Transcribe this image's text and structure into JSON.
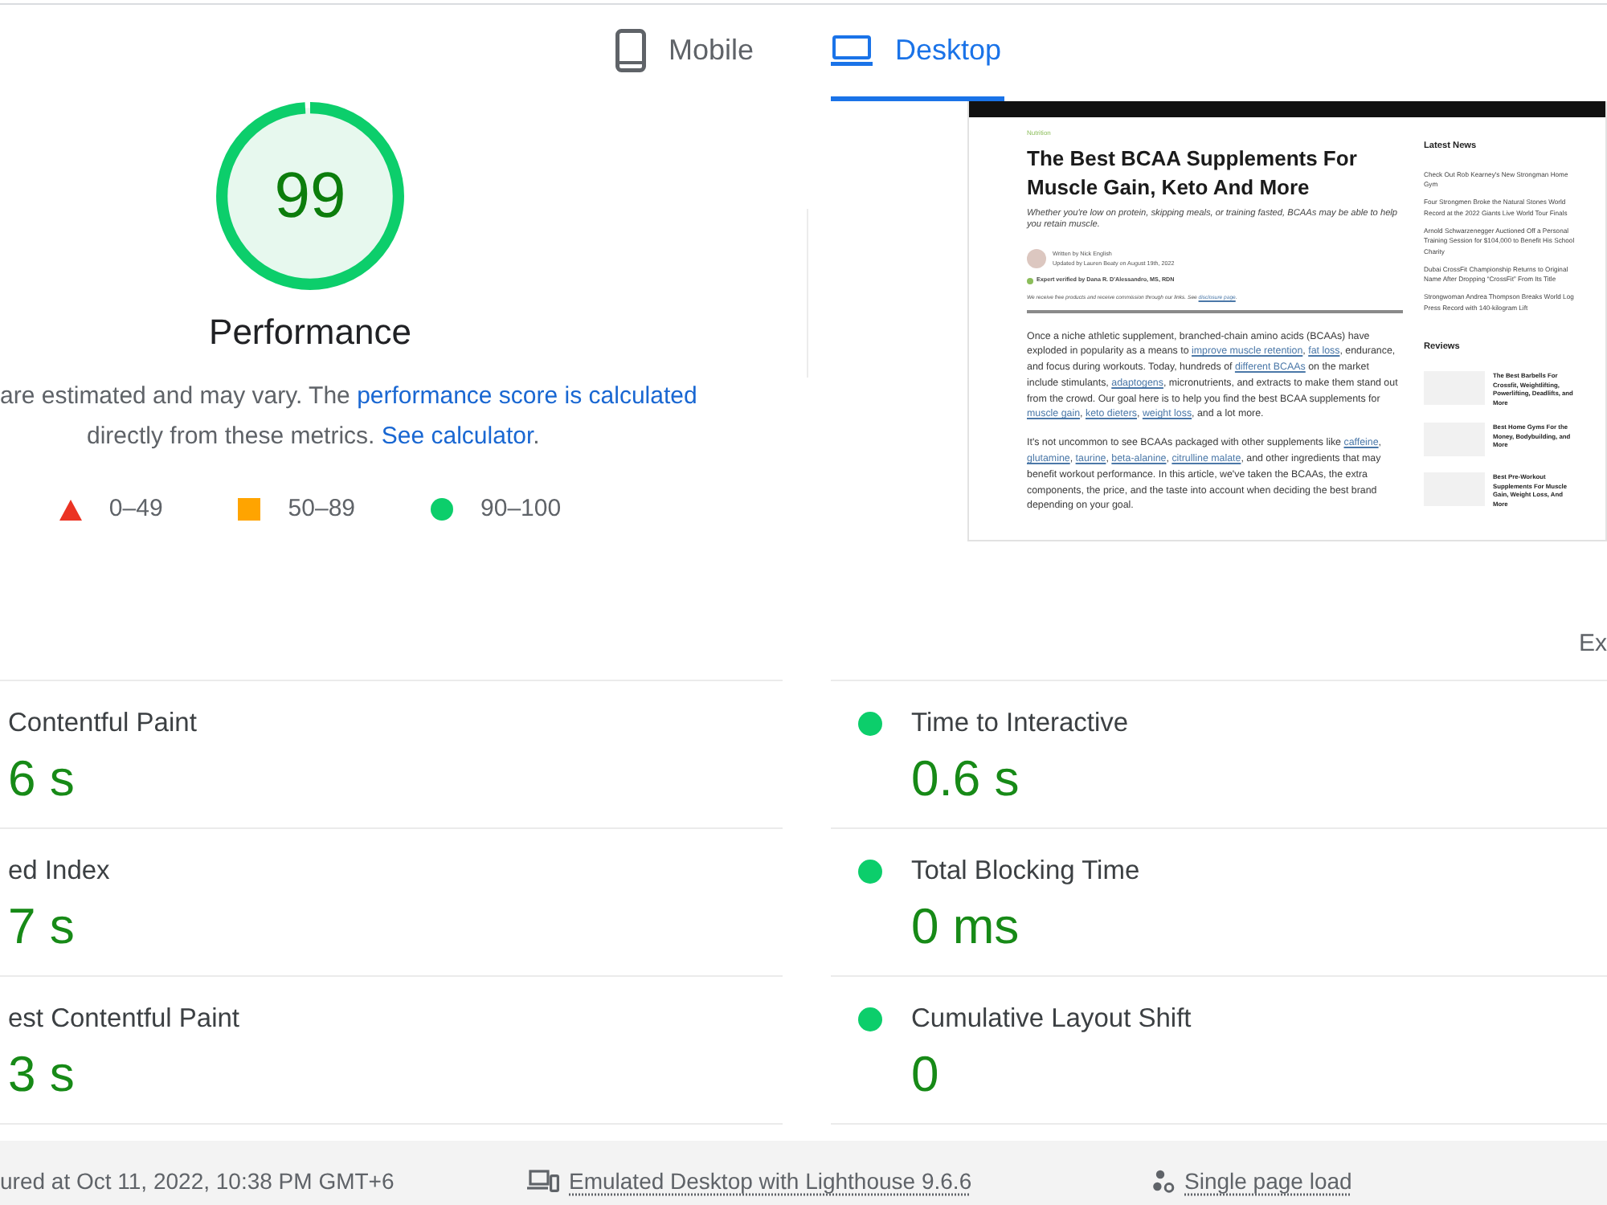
{
  "tabs": [
    {
      "kind": "phone",
      "label": "Mobile",
      "selected": false
    },
    {
      "kind": "laptop",
      "label": "Desktop",
      "selected": true
    }
  ],
  "score": {
    "value": "99",
    "level": 0.99,
    "label": "Performance"
  },
  "note": [
    {
      "kind": "text",
      "text": "are estimated and may vary. The "
    },
    {
      "kind": "link",
      "text": "performance score is calculated"
    },
    {
      "kind": "text",
      "text": " directly from these metrics. "
    },
    {
      "kind": "link",
      "text": "See calculator"
    },
    {
      "kind": "text",
      "text": "."
    }
  ],
  "legend": [
    {
      "kind": "triangle",
      "color": "#eb3323",
      "label": "0–49"
    },
    {
      "kind": "square",
      "color": "#ffa400",
      "label": "50–89"
    },
    {
      "kind": "circle",
      "color": "#0cce6b",
      "label": "90–100"
    }
  ],
  "page_preview": {
    "category": "Nutrition",
    "title": "The Best BCAA Supplements For Muscle Gain, Keto And More",
    "subtitle": "Whether you're low on protein, skipping meals, or training fasted, BCAAs may be able to help you retain muscle.",
    "byline": [
      "Written by Nick English",
      "Updated by Lauren Beaty on August 19th, 2022"
    ],
    "expert": "Expert verified by Dana R. D'Alessandro, MS, RDN",
    "disclosure": [
      {
        "kind": "text",
        "text": "We receive free products and receive commission through our links. See "
      },
      {
        "kind": "link",
        "text": "disclosure page"
      },
      {
        "kind": "text",
        "text": "."
      }
    ],
    "paragraphs": [
      [
        {
          "kind": "text",
          "text": "Once a niche athletic supplement, branched-chain amino acids (BCAAs) have exploded in popularity as a means to "
        },
        {
          "kind": "link",
          "text": "improve muscle retention"
        },
        {
          "kind": "text",
          "text": ", "
        },
        {
          "kind": "link",
          "text": "fat loss"
        },
        {
          "kind": "text",
          "text": ", endurance, and focus during workouts. Today, hundreds of "
        },
        {
          "kind": "link",
          "text": "different BCAAs"
        },
        {
          "kind": "text",
          "text": " on the market include stimulants, "
        },
        {
          "kind": "link",
          "text": "adaptogens"
        },
        {
          "kind": "text",
          "text": ", micronutrients, and extracts to make them stand out from the crowd. Our goal here is to help you find the best BCAA supplements for "
        },
        {
          "kind": "link",
          "text": "muscle gain"
        },
        {
          "kind": "text",
          "text": ", "
        },
        {
          "kind": "link",
          "text": "keto dieters"
        },
        {
          "kind": "text",
          "text": ", "
        },
        {
          "kind": "link",
          "text": "weight loss"
        },
        {
          "kind": "text",
          "text": ", and a lot more."
        }
      ],
      [
        {
          "kind": "text",
          "text": "It's not uncommon to see BCAAs packaged with other supplements like "
        },
        {
          "kind": "link",
          "text": "caffeine"
        },
        {
          "kind": "text",
          "text": ", "
        },
        {
          "kind": "link",
          "text": "glutamine"
        },
        {
          "kind": "text",
          "text": ", "
        },
        {
          "kind": "link",
          "text": "taurine"
        },
        {
          "kind": "text",
          "text": ", "
        },
        {
          "kind": "link",
          "text": "beta-alanine"
        },
        {
          "kind": "text",
          "text": ", "
        },
        {
          "kind": "link",
          "text": "citrulline malate"
        },
        {
          "kind": "text",
          "text": ", and other ingredients that may benefit workout performance. In this article, we've taken the BCAAs, the extra components, the price, and the taste into account when deciding the best brand depending on your goal."
        }
      ]
    ],
    "news_heading": "Latest News",
    "news": [
      "Check Out Rob Kearney's New Strongman Home Gym",
      "Four Strongmen Broke the Natural Stones World Record at the 2022 Giants Live World Tour Finals",
      "Arnold Schwarzenegger Auctioned Off a Personal Training Session for $104,000 to Benefit His School Charity",
      "Dubai CrossFit Championship Returns to Original Name After Dropping “CrossFit” From Its Title",
      "Strongwoman Andrea Thompson Breaks World Log Press Record with 140-kilogram Lift"
    ],
    "reviews_heading": "Reviews",
    "reviews": [
      "The Best Barbells For Crossfit, Weightlifting, Powerlifting, Deadlifts, and More",
      "Best Home Gyms For the Money, Bodybuilding, and More",
      "Best Pre-Workout Supplements For Muscle Gain, Weight Loss, And More"
    ]
  },
  "metrics_toggle": "Ex",
  "metrics": [
    {
      "label": "Contentful Paint",
      "value": "6 s"
    },
    {
      "label": "Time to Interactive",
      "value": "0.6 s",
      "color": "#0cce6b"
    },
    {
      "label": "ed Index",
      "value": "7 s"
    },
    {
      "label": "Total Blocking Time",
      "value": "0 ms",
      "color": "#0cce6b"
    },
    {
      "label": "est Contentful Paint",
      "value": "3 s"
    },
    {
      "label": "Cumulative Layout Shift",
      "value": "0",
      "color": "#0cce6b"
    }
  ],
  "footer": [
    {
      "kind": "text",
      "text": "ured at Oct 11, 2022, 10:38 PM GMT+6"
    },
    {
      "kind": "device",
      "text": "Emulated Desktop with Lighthouse 9.6.6"
    },
    {
      "kind": "load",
      "text": "Single page load"
    }
  ]
}
